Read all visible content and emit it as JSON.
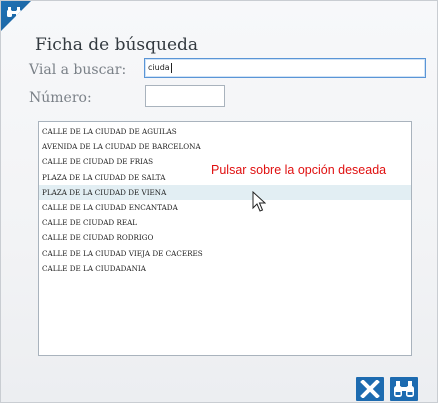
{
  "dialog": {
    "title": "Ficha de búsqueda",
    "vial_label": "Vial a buscar:",
    "numero_label": "Número:",
    "vial_value": "ciuda",
    "numero_value": "",
    "hint": "Pulsar sobre la opción deseada",
    "accent_color": "#1d6bb0",
    "hint_color": "#e01010"
  },
  "results": [
    "CALLE DE LA CIUDAD DE AGUILAS",
    "AVENIDA DE LA CIUDAD DE BARCELONA",
    "CALLE DE CIUDAD DE FRIAS",
    "PLAZA DE LA CIUDAD DE SALTA",
    "PLAZA DE LA CIUDAD DE VIENA",
    "CALLE DE LA CIUDAD ENCANTADA",
    "CALLE DE CIUDAD REAL",
    "CALLE DE CIUDAD RODRIGO",
    "CALLE DE LA CIUDAD VIEJA DE CACERES",
    "CALLE DE LA CIUDADANIA"
  ],
  "hovered_index": 4,
  "icons": {
    "corner": "binoculars-icon",
    "close_button": "close-icon",
    "search_button": "binoculars-icon"
  }
}
